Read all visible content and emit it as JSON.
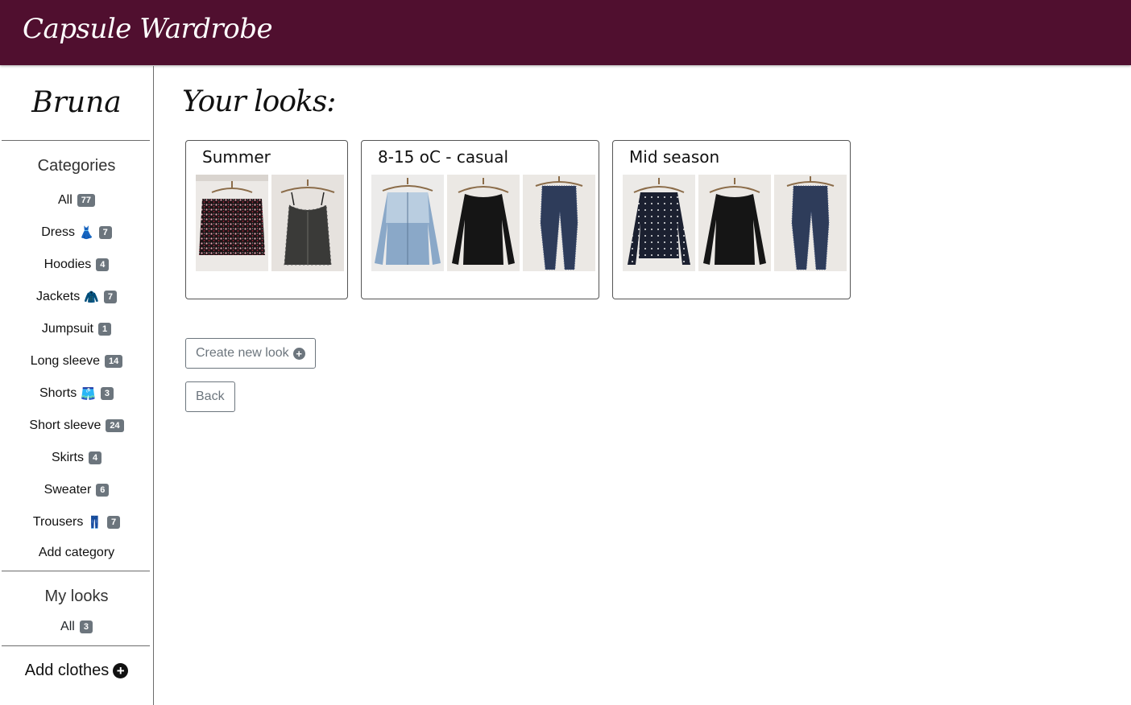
{
  "app": {
    "title": "Capsule Wardrobe"
  },
  "sidebar": {
    "user": "Bruna",
    "categories_title": "Categories",
    "categories": [
      {
        "label": "All",
        "count": "77",
        "emoji": ""
      },
      {
        "label": "Dress",
        "count": "7",
        "emoji": "👗"
      },
      {
        "label": "Hoodies",
        "count": "4",
        "emoji": ""
      },
      {
        "label": "Jackets",
        "count": "7",
        "emoji": "🧥"
      },
      {
        "label": "Jumpsuit",
        "count": "1",
        "emoji": ""
      },
      {
        "label": "Long sleeve",
        "count": "14",
        "emoji": ""
      },
      {
        "label": "Shorts",
        "count": "3",
        "emoji": "🩳"
      },
      {
        "label": "Short sleeve",
        "count": "24",
        "emoji": ""
      },
      {
        "label": "Skirts",
        "count": "4",
        "emoji": ""
      },
      {
        "label": "Sweater",
        "count": "6",
        "emoji": ""
      },
      {
        "label": "Trousers",
        "count": "7",
        "emoji": "👖"
      }
    ],
    "add_category": "Add category",
    "my_looks_title": "My looks",
    "my_looks_all": {
      "label": "All",
      "count": "3"
    },
    "add_clothes": "Add clothes"
  },
  "main": {
    "title": "Your looks:",
    "looks": [
      {
        "name": "Summer",
        "items": [
          "floral-skirt",
          "camisole-top"
        ]
      },
      {
        "name": "8-15 oC - casual",
        "items": [
          "denim-shirt",
          "black-long-sleeve",
          "jeans"
        ]
      },
      {
        "name": "Mid season",
        "items": [
          "polka-dot-blouse",
          "black-long-sleeve",
          "jeans"
        ]
      }
    ],
    "create_button": "Create new look",
    "back_button": "Back"
  },
  "colors": {
    "header_bg": "#500f2f",
    "badge_bg": "#6c757d",
    "button_text": "#6c757d"
  }
}
